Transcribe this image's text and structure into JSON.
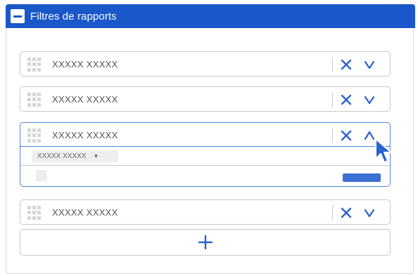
{
  "panel": {
    "title": "Filtres de rapports",
    "collapse_icon": "minus-icon"
  },
  "filters": [
    {
      "label": "XXXXX XXXXX",
      "expanded": false
    },
    {
      "label": "XXXXX XXXXX",
      "expanded": false
    },
    {
      "label": "XXXXX XXXXX",
      "expanded": true
    },
    {
      "label": "XXXXX XXXXX",
      "expanded": false
    }
  ],
  "expanded_filter": {
    "select_value": "XXXXX XXXXX",
    "select_caret": "▼",
    "checkbox_checked": false
  },
  "icons": {
    "drag": "drag-handle-icon",
    "remove": "close-icon",
    "collapsed": "chevron-down-icon",
    "expanded": "chevron-up-icon",
    "add": "plus-icon",
    "cursor": "mouse-pointer-icon"
  },
  "colors": {
    "header": "#1a57c9",
    "accent": "#2a62cf",
    "border": "#c8c8c8",
    "active_border": "#4f86e0"
  }
}
